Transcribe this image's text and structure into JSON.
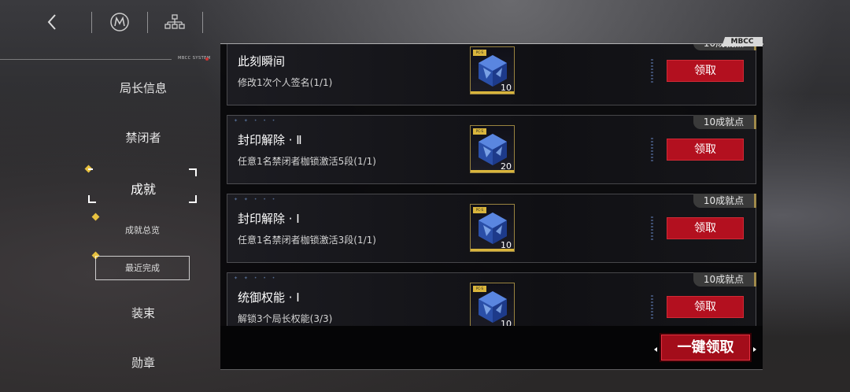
{
  "topbar": {
    "back_icon": "chevron-left-icon",
    "logo_icon": "mbcc-logo-icon",
    "org_icon": "hierarchy-icon"
  },
  "system_label": "MBCC SYSTEM",
  "panel_tag": "MBCC",
  "nav": {
    "items": [
      {
        "label": "局长信息"
      },
      {
        "label": "禁闭者"
      },
      {
        "label": "成就"
      },
      {
        "label": "装束"
      },
      {
        "label": "勋章"
      }
    ],
    "subitems": [
      {
        "label": "成就总览"
      },
      {
        "label": "最近完成"
      }
    ],
    "active": "成就",
    "active_sub": "最近完成"
  },
  "achievements": [
    {
      "title": "此刻瞬间",
      "desc": "修改1次个人签名(1/1)",
      "reward_count": "10",
      "points": "10成就点",
      "claim_label": "领取"
    },
    {
      "title": "封印解除 · Ⅱ",
      "desc": "任意1名禁闭者枷锁激活5段(1/1)",
      "reward_count": "20",
      "points": "10成就点",
      "claim_label": "领取"
    },
    {
      "title": "封印解除 · Ⅰ",
      "desc": "任意1名禁闭者枷锁激活3段(1/1)",
      "reward_count": "10",
      "points": "10成就点",
      "claim_label": "领取"
    },
    {
      "title": "统御权能 · Ⅰ",
      "desc": "解锁3个局长权能(3/3)",
      "reward_count": "10",
      "points": "10成就点",
      "claim_label": "领取"
    }
  ],
  "reward_tag": "PC-S",
  "claim_all_label": "一键领取",
  "colors": {
    "accent_red": "#b3101f",
    "gold": "#d9b53c",
    "selected_diamond": "#e8c240"
  }
}
